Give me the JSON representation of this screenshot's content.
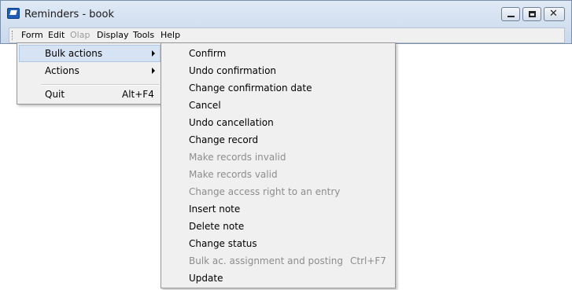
{
  "window": {
    "title": "Reminders - book",
    "icon": "app-icon"
  },
  "menubar": {
    "items": [
      {
        "label": "Form",
        "enabled": true
      },
      {
        "label": "Edit",
        "enabled": true
      },
      {
        "label": "Olap",
        "enabled": false
      },
      {
        "label": "Display",
        "enabled": true
      },
      {
        "label": "Tools",
        "enabled": true
      },
      {
        "label": "Help",
        "enabled": true
      }
    ]
  },
  "form_menu": {
    "items": [
      {
        "label": "Bulk actions",
        "submenu": true,
        "highlighted": true
      },
      {
        "label": "Actions",
        "submenu": true
      },
      {
        "label": "Quit",
        "shortcut": "Alt+F4"
      }
    ]
  },
  "bulk_actions_menu": {
    "items": [
      {
        "label": "Confirm",
        "enabled": true
      },
      {
        "label": "Undo confirmation",
        "enabled": true
      },
      {
        "label": "Change confirmation date",
        "enabled": true
      },
      {
        "label": "Cancel",
        "enabled": true
      },
      {
        "label": "Undo cancellation",
        "enabled": true
      },
      {
        "label": "Change record",
        "enabled": true
      },
      {
        "label": "Make records invalid",
        "enabled": false
      },
      {
        "label": "Make records valid",
        "enabled": false
      },
      {
        "label": "Change access right to an entry",
        "enabled": false
      },
      {
        "label": "Insert note",
        "enabled": true
      },
      {
        "label": "Delete note",
        "enabled": true
      },
      {
        "label": "Change status",
        "enabled": true
      },
      {
        "label": "Bulk ac. assignment and posting",
        "enabled": false,
        "shortcut": "Ctrl+F7"
      },
      {
        "label": "Update",
        "enabled": true
      }
    ]
  }
}
